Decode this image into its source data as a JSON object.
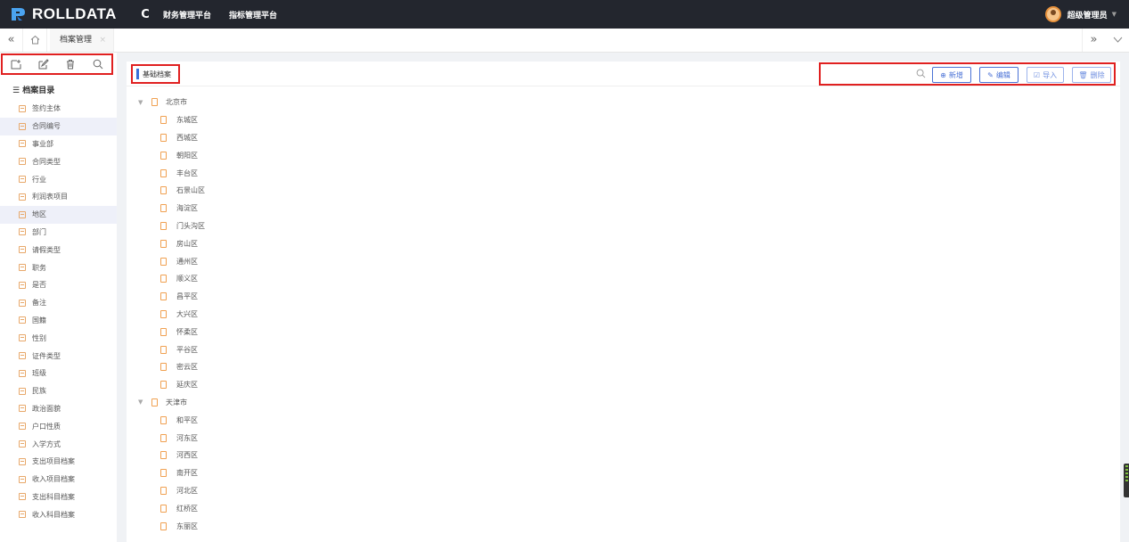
{
  "app": {
    "brand": "ROLLDATA",
    "top_nav": [
      "财务管理平台",
      "指标管理平台"
    ],
    "user_name": "超级管理员"
  },
  "tabs": {
    "active_label": "档案管理",
    "close_symbol": "×"
  },
  "sidebar": {
    "title": "档案目录",
    "items": [
      {
        "label": "签约主体"
      },
      {
        "label": "合同编号"
      },
      {
        "label": "事业部"
      },
      {
        "label": "合同类型"
      },
      {
        "label": "行业"
      },
      {
        "label": "利润表项目"
      },
      {
        "label": "地区"
      },
      {
        "label": "部门"
      },
      {
        "label": "请假类型"
      },
      {
        "label": "职务"
      },
      {
        "label": "是否"
      },
      {
        "label": "备注"
      },
      {
        "label": "国籍"
      },
      {
        "label": "性别"
      },
      {
        "label": "证件类型"
      },
      {
        "label": "班级"
      },
      {
        "label": "民族"
      },
      {
        "label": "政治面貌"
      },
      {
        "label": "户口性质"
      },
      {
        "label": "入学方式"
      },
      {
        "label": "支出项目档案"
      },
      {
        "label": "收入项目档案"
      },
      {
        "label": "支出科目档案"
      },
      {
        "label": "收入科目档案"
      }
    ],
    "highlighted_items": [
      "合同编号",
      "地区"
    ]
  },
  "main": {
    "breadcrumb": "基础档案",
    "search": {
      "value": "",
      "placeholder": ""
    },
    "buttons": {
      "add": "新增",
      "edit": "编辑",
      "import": "导入",
      "delete": "删除"
    },
    "tree": [
      {
        "label": "北京市",
        "children": [
          "东城区",
          "西城区",
          "朝阳区",
          "丰台区",
          "石景山区",
          "海淀区",
          "门头沟区",
          "房山区",
          "通州区",
          "顺义区",
          "昌平区",
          "大兴区",
          "怀柔区",
          "平谷区",
          "密云区",
          "延庆区"
        ]
      },
      {
        "label": "天津市",
        "children": [
          "和平区",
          "河东区",
          "河西区",
          "南开区",
          "河北区",
          "红桥区",
          "东丽区"
        ]
      }
    ]
  },
  "colors": {
    "topbar_bg": "#23262e",
    "accent_blue": "#3a6fd8",
    "highlight_red": "#e02020",
    "file_orange": "#f0a050"
  }
}
